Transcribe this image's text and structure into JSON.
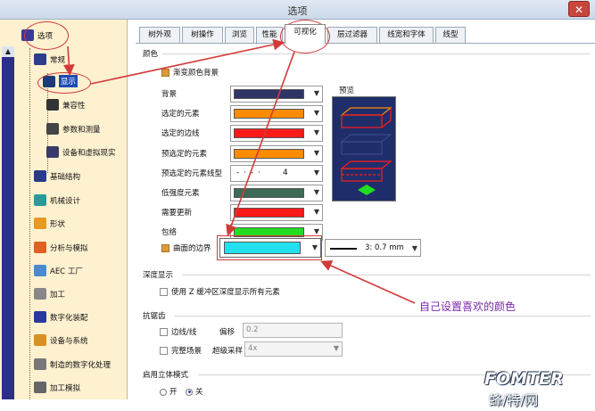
{
  "window": {
    "title": "选项",
    "close_icon": "close-icon"
  },
  "tree": {
    "items": [
      {
        "label": "选项",
        "icon": "options-root-icon"
      },
      {
        "label": "常规",
        "icon": "general-icon"
      },
      {
        "label": "显示",
        "icon": "display-icon",
        "selected": true
      },
      {
        "label": "兼容性",
        "icon": "compatibility-icon"
      },
      {
        "label": "参数和测量",
        "icon": "parameters-icon"
      },
      {
        "label": "设备和虚拟现实",
        "icon": "devices-icon"
      },
      {
        "label": "基础结构",
        "icon": "infrastructure-icon"
      },
      {
        "label": "机械设计",
        "icon": "mechanical-design-icon"
      },
      {
        "label": "形状",
        "icon": "shape-icon"
      },
      {
        "label": "分析与模拟",
        "icon": "analysis-icon"
      },
      {
        "label": "AEC 工厂",
        "icon": "aec-plant-icon"
      },
      {
        "label": "加工",
        "icon": "machining-icon"
      },
      {
        "label": "数字化装配",
        "icon": "digital-mockup-icon"
      },
      {
        "label": "设备与系统",
        "icon": "equipment-icon"
      },
      {
        "label": "制造的数字化处理",
        "icon": "manufacturing-icon"
      },
      {
        "label": "加工模拟",
        "icon": "machining-sim-icon"
      }
    ]
  },
  "tabs": [
    "树外观",
    "树操作",
    "浏览",
    "性能",
    "可视化",
    "层过滤器",
    "线宽和字体",
    "线型"
  ],
  "active_tab": "可视化",
  "sections": {
    "color": "颜色",
    "depth": "深度显示",
    "antialias": "抗锯齿",
    "stereo": "启用立体模式"
  },
  "gradient_bg": "渐变颜色背景",
  "preview_label": "预览",
  "color_rows": [
    {
      "label": "背景",
      "color": "#2f3466"
    },
    {
      "label": "选定的元素",
      "color": "#ff8c00"
    },
    {
      "label": "选定的边线",
      "color": "#ff1a1a"
    },
    {
      "label": "预选定的元素",
      "color": "#ff8c00"
    },
    {
      "label": "预选定的元素线型",
      "linetype": "- · - ·",
      "value": "4"
    },
    {
      "label": "低强度元素",
      "color": "#3c6b55"
    },
    {
      "label": "需要更新",
      "color": "#ff1a1a"
    },
    {
      "label": "包络",
      "color": "#22dd22"
    }
  ],
  "surface_edge": {
    "label": "曲面的边界",
    "color": "#22e0ee",
    "thickness": "3: 0.7 mm"
  },
  "depth_option": "使用 Z 缓冲区深度显示所有元素",
  "antialias": {
    "edges": "边线/线",
    "offset_label": "偏移",
    "offset_value": "0.2",
    "full_scene": "完整场景",
    "supersample_label": "超级采样",
    "supersample_value": "4x"
  },
  "stereo": {
    "on": "开",
    "off": "关"
  },
  "annotation": "自己设置喜欢的颜色",
  "watermark": {
    "brand": "FOMTER",
    "cn": "蜂/特/网"
  },
  "colors": {
    "accent": "#1d4bb3",
    "tree_bg": "#fdf1d0",
    "annotation": "#7b2aa8",
    "callout": "#d23a3a"
  }
}
